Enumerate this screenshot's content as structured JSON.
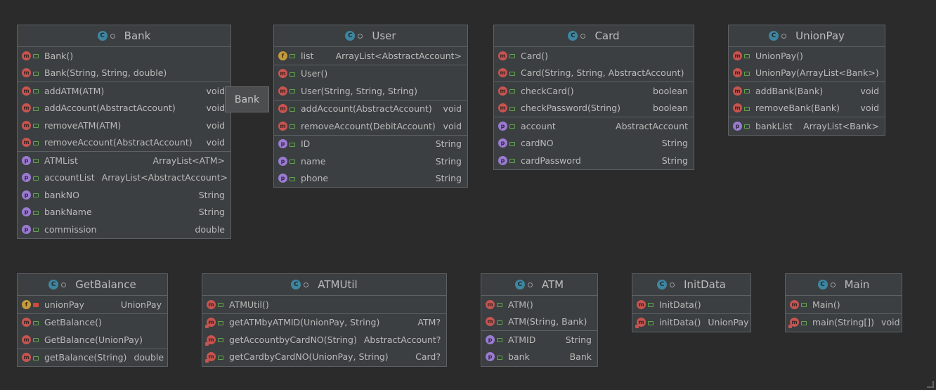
{
  "tooltip": "Bank",
  "classes": {
    "bank": {
      "title": "Bank",
      "rows": [
        {
          "kind": "m",
          "name": "Bank()",
          "type": ""
        },
        {
          "kind": "m",
          "name": "Bank(String, String, double)",
          "type": ""
        },
        {
          "kind": "m",
          "name": "addATM(ATM)",
          "type": "void"
        },
        {
          "kind": "m",
          "name": "addAccount(AbstractAccount)",
          "type": "void"
        },
        {
          "kind": "m",
          "name": "removeATM(ATM)",
          "type": "void"
        },
        {
          "kind": "m",
          "name": "removeAccount(AbstractAccount)",
          "type": "void"
        },
        {
          "kind": "p",
          "name": "ATMList",
          "type": "ArrayList<ATM>"
        },
        {
          "kind": "p",
          "name": "accountList",
          "type": "ArrayList<AbstractAccount>"
        },
        {
          "kind": "p",
          "name": "bankNO",
          "type": "String"
        },
        {
          "kind": "p",
          "name": "bankName",
          "type": "String"
        },
        {
          "kind": "p",
          "name": "commission",
          "type": "double"
        }
      ]
    },
    "user": {
      "title": "User",
      "rows": [
        {
          "kind": "f",
          "name": "list",
          "type": "ArrayList<AbstractAccount>"
        },
        {
          "kind": "m",
          "name": "User()",
          "type": ""
        },
        {
          "kind": "m",
          "name": "User(String, String, String)",
          "type": ""
        },
        {
          "kind": "m",
          "name": "addAccount(AbstractAccount)",
          "type": "void"
        },
        {
          "kind": "m",
          "name": "removeAccount(DebitAccount)",
          "type": "void"
        },
        {
          "kind": "p",
          "name": "ID",
          "type": "String"
        },
        {
          "kind": "p",
          "name": "name",
          "type": "String"
        },
        {
          "kind": "p",
          "name": "phone",
          "type": "String"
        }
      ]
    },
    "card": {
      "title": "Card",
      "rows": [
        {
          "kind": "m",
          "name": "Card()",
          "type": ""
        },
        {
          "kind": "m",
          "name": "Card(String, String, AbstractAccount)",
          "type": ""
        },
        {
          "kind": "m",
          "name": "checkCard()",
          "type": "boolean"
        },
        {
          "kind": "m",
          "name": "checkPassword(String)",
          "type": "boolean"
        },
        {
          "kind": "p",
          "name": "account",
          "type": "AbstractAccount"
        },
        {
          "kind": "p",
          "name": "cardNO",
          "type": "String"
        },
        {
          "kind": "p",
          "name": "cardPassword",
          "type": "String"
        }
      ]
    },
    "unionpay": {
      "title": "UnionPay",
      "rows": [
        {
          "kind": "m",
          "name": "UnionPay()",
          "type": ""
        },
        {
          "kind": "m",
          "name": "UnionPay(ArrayList<Bank>)",
          "type": ""
        },
        {
          "kind": "m",
          "name": "addBank(Bank)",
          "type": "void"
        },
        {
          "kind": "m",
          "name": "removeBank(Bank)",
          "type": "void"
        },
        {
          "kind": "p",
          "name": "bankList",
          "type": "ArrayList<Bank>"
        }
      ]
    },
    "getbalance": {
      "title": "GetBalance",
      "rows": [
        {
          "kind": "f",
          "name": "unionPay",
          "type": "UnionPay"
        },
        {
          "kind": "m",
          "name": "GetBalance()",
          "type": ""
        },
        {
          "kind": "m",
          "name": "GetBalance(UnionPay)",
          "type": ""
        },
        {
          "kind": "m",
          "name": "getBalance(String)",
          "type": "double"
        }
      ]
    },
    "atmutil": {
      "title": "ATMUtil",
      "rows": [
        {
          "kind": "m",
          "name": "ATMUtil()",
          "type": ""
        },
        {
          "kind": "m",
          "name": "getATMbyATMID(UnionPay, String)",
          "type": "ATM?"
        },
        {
          "kind": "m",
          "name": "getAccountbyCardNO(String)",
          "type": "AbstractAccount?"
        },
        {
          "kind": "m",
          "name": "getCardbyCardNO(UnionPay, String)",
          "type": "Card?"
        }
      ]
    },
    "atm": {
      "title": "ATM",
      "rows": [
        {
          "kind": "m",
          "name": "ATM()",
          "type": ""
        },
        {
          "kind": "m",
          "name": "ATM(String, Bank)",
          "type": ""
        },
        {
          "kind": "p",
          "name": "ATMID",
          "type": "String"
        },
        {
          "kind": "p",
          "name": "bank",
          "type": "Bank"
        }
      ]
    },
    "initdata": {
      "title": "InitData",
      "rows": [
        {
          "kind": "m",
          "name": "InitData()",
          "type": ""
        },
        {
          "kind": "m",
          "name": "initData()",
          "type": "UnionPay"
        }
      ]
    },
    "main": {
      "title": "Main",
      "rows": [
        {
          "kind": "m",
          "name": "Main()",
          "type": ""
        },
        {
          "kind": "m",
          "name": "main(String[])",
          "type": "void"
        }
      ]
    }
  }
}
